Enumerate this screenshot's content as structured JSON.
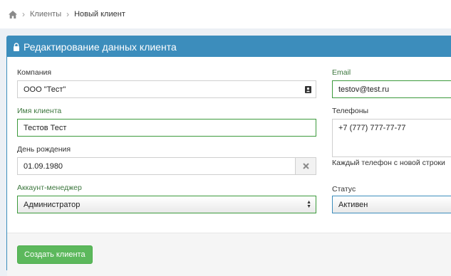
{
  "breadcrumb": {
    "items": [
      "Клиенты",
      "Новый клиент"
    ]
  },
  "panel": {
    "title": "Редактирование данных клиента"
  },
  "form": {
    "company": {
      "label": "Компания",
      "value": "ООО \"Тест\""
    },
    "email": {
      "label": "Email",
      "value": "testov@test.ru"
    },
    "client_name": {
      "label": "Имя клиента",
      "value": "Тестов Тест"
    },
    "phones": {
      "label": "Телефоны",
      "value": "+7 (777) 777-77-77",
      "hint": "Каждый телефон с новой строки"
    },
    "birthday": {
      "label": "День рождения",
      "value": "01.09.1980"
    },
    "account_manager": {
      "label": "Аккаунт-менеджер",
      "value": "Администратор"
    },
    "status": {
      "label": "Статус",
      "value": "Активен"
    }
  },
  "actions": {
    "create_label": "Создать клиента"
  },
  "colors": {
    "header": "#3c8dbc",
    "success": "#5cb85c",
    "valid_border": "#3c9a3c",
    "valid_label": "#3c763d"
  },
  "icons": [
    "home-icon",
    "lock-icon",
    "contact-card-icon",
    "clear-icon",
    "select-caret-icon"
  ]
}
